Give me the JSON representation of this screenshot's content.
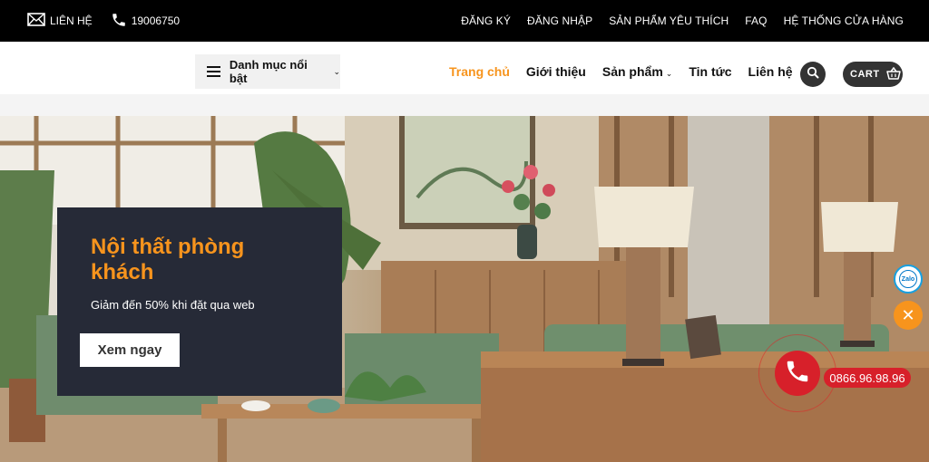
{
  "topbar": {
    "contact_label": "LIÊN HỆ",
    "phone": "19006750",
    "links": [
      "ĐĂNG KÝ",
      "ĐĂNG NHẬP",
      "SẢN PHẨM YÊU THÍCH",
      "FAQ",
      "HỆ THỐNG CỬA HÀNG"
    ]
  },
  "header": {
    "category_label": "Danh mục nổi bật",
    "nav": [
      {
        "label": "Trang chủ",
        "active": true
      },
      {
        "label": "Giới thiệu"
      },
      {
        "label": "Sản phẩm",
        "has_dropdown": true
      },
      {
        "label": "Tin tức"
      },
      {
        "label": "Liên hệ"
      }
    ],
    "cart_label": "CART"
  },
  "hero": {
    "title": "Nội thất phòng khách",
    "subtitle": "Giảm đến 50% khi đặt qua web",
    "button_label": "Xem ngay"
  },
  "widgets": {
    "zalo_label": "Zalo",
    "hotline": "0866.96.98.96"
  },
  "colors": {
    "accent": "#f7941d",
    "topbar_bg": "#000000",
    "promo_bg": "#262a37",
    "call_red": "#d7202a"
  },
  "icons": [
    "mail-icon",
    "phone-icon",
    "menu-icon",
    "chevron-down-icon",
    "search-icon",
    "cart-icon",
    "close-icon",
    "zalo-icon"
  ]
}
